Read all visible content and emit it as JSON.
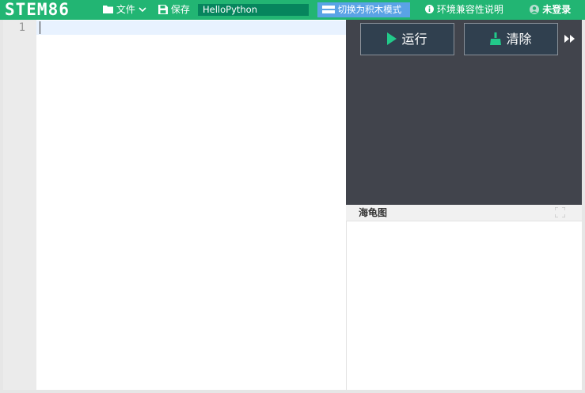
{
  "app": {
    "logo": "STEM86"
  },
  "toolbar": {
    "file_label": "文件",
    "save_label": "保存",
    "project_name": "HelloPython",
    "switch_label": "切换为积木模式",
    "compat_label": "环境兼容性说明",
    "login_label": "未登录"
  },
  "editor": {
    "line_numbers": [
      "1"
    ]
  },
  "console": {
    "run_label": "运行",
    "clear_label": "清除"
  },
  "turtle": {
    "title": "海龟图"
  },
  "colors": {
    "brand": "#22b573",
    "console_bg": "#41444c",
    "switch_btn": "#5aa3e6",
    "run_accent": "#22c98a"
  },
  "icons": [
    "folder-icon",
    "chevron-down-icon",
    "save-icon",
    "blocks-icon",
    "info-icon",
    "user-icon",
    "play-icon",
    "broom-icon",
    "fast-forward-icon",
    "fullscreen-icon"
  ]
}
